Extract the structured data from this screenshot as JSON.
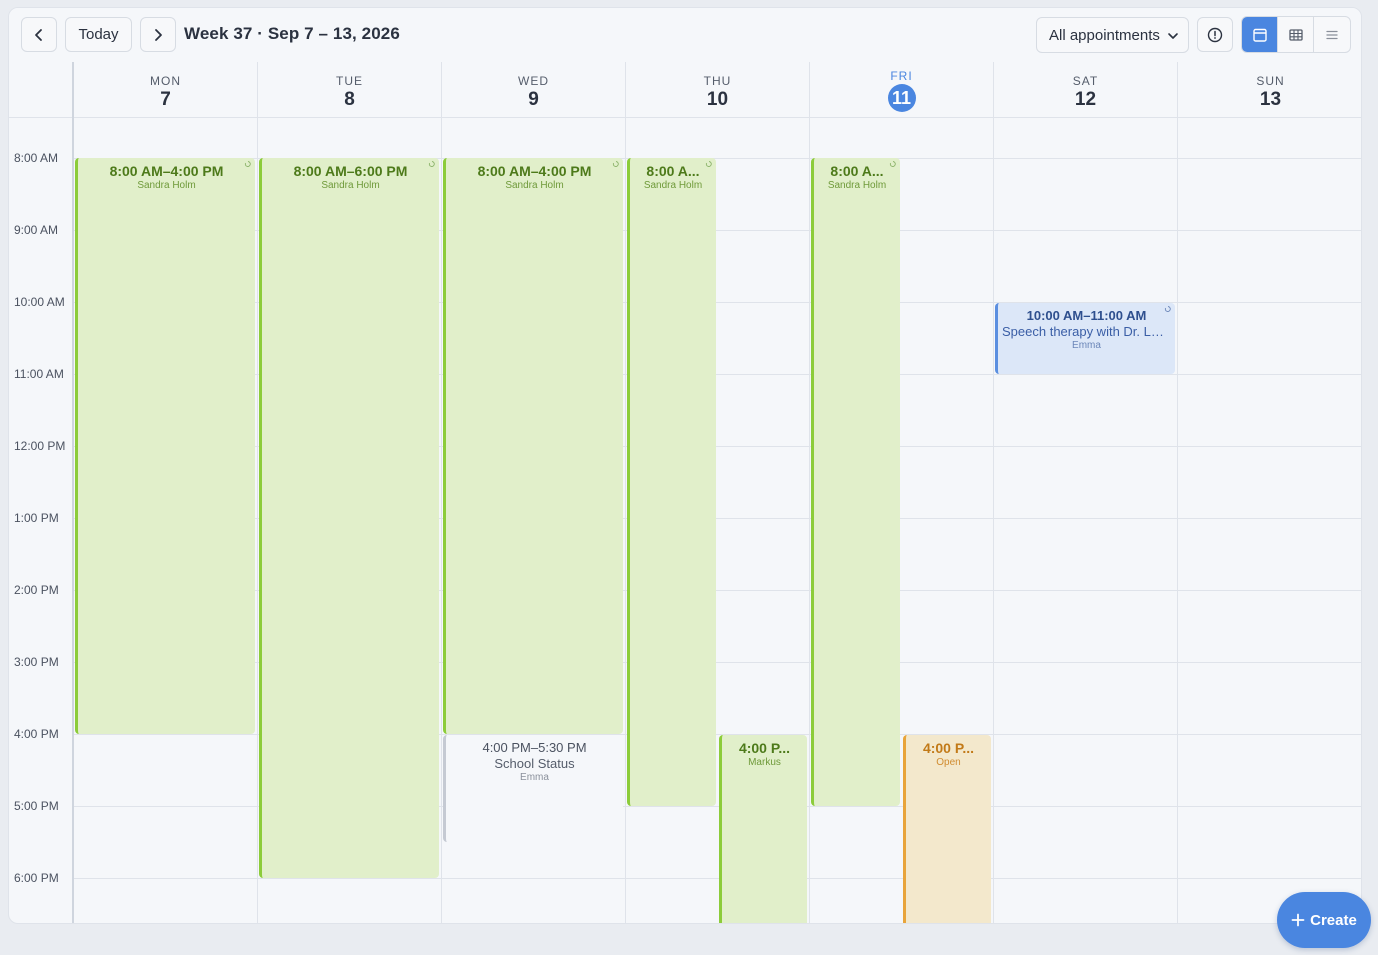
{
  "toolbar": {
    "today_label": "Today",
    "week_title": "Week 37 · Sep 7 – 13, 2026",
    "filter_value": "All appointments"
  },
  "days": [
    {
      "name": "MON",
      "num": "7"
    },
    {
      "name": "TUE",
      "num": "8"
    },
    {
      "name": "WED",
      "num": "9"
    },
    {
      "name": "THU",
      "num": "10"
    },
    {
      "name": "FRI",
      "num": "11"
    },
    {
      "name": "SAT",
      "num": "12"
    },
    {
      "name": "SUN",
      "num": "13"
    }
  ],
  "hours": [
    "8:00 AM",
    "9:00 AM",
    "10:00 AM",
    "11:00 AM",
    "12:00 PM",
    "1:00 PM",
    "2:00 PM",
    "3:00 PM",
    "4:00 PM",
    "5:00 PM",
    "6:00 PM"
  ],
  "events": {
    "mon": {
      "time": "8:00 AM–4:00 PM",
      "person": "Sandra Holm"
    },
    "tue": {
      "time": "8:00 AM–6:00 PM",
      "person": "Sandra Holm"
    },
    "wed": {
      "time": "8:00 AM–4:00 PM",
      "person": "Sandra Holm"
    },
    "wed_school": {
      "time": "4:00 PM–5:30 PM",
      "title": "School Status",
      "person": "Emma"
    },
    "thu": {
      "time": "8:00 A...",
      "person": "Sandra Holm"
    },
    "thu_markus": {
      "time": "4:00 P...",
      "person": "Markus"
    },
    "fri": {
      "time": "8:00 A...",
      "person": "Sandra Holm"
    },
    "fri_open": {
      "time": "4:00 P...",
      "person": "Open"
    },
    "sat": {
      "time": "10:00 AM–11:00 AM",
      "title": "Speech therapy with Dr. Lund",
      "person": "Emma"
    }
  },
  "create_label": "Create",
  "colors": {
    "accent": "#4a86e0",
    "green": "#8ccc3a",
    "orange": "#e8a43a"
  }
}
